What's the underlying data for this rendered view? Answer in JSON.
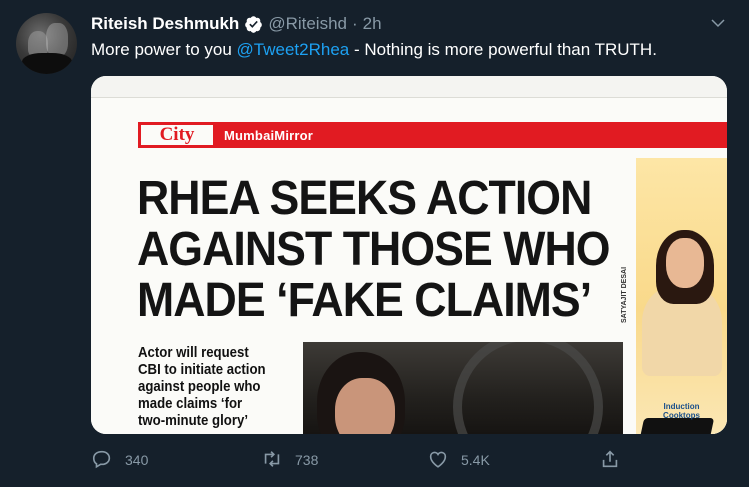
{
  "tweet": {
    "author": {
      "name": "Riteish Deshmukh",
      "handle": "@Riteishd",
      "separator": "·",
      "time": "2h",
      "verified": true
    },
    "text": {
      "before": "More power to you ",
      "mention": "@Tweet2Rhea",
      "after": " - Nothing is more powerful than TRUTH."
    },
    "media": {
      "section": "City",
      "masthead": "MumbaiMirror",
      "headline": [
        "RHEA SEEKS ACTION",
        "AGAINST THOSE WHO",
        "MADE ‘FAKE CLAIMS’"
      ],
      "subhead": [
        "Actor will request",
        "CBI to initiate action",
        "against people who",
        "made claims ‘for",
        "two-minute glory’"
      ],
      "photo_credit": "SATYAJIT DESAI",
      "ad_text": [
        "Induction",
        "Cooktops"
      ]
    },
    "actions": {
      "replies": "340",
      "retweets": "738",
      "likes": "5.4K"
    }
  },
  "colors": {
    "background": "#15202b",
    "secondary_text": "#8899a6",
    "link": "#1da1f2",
    "newspaper_red": "#e11b22"
  },
  "icons": [
    "verified-badge-icon",
    "chevron-down-icon",
    "reply-icon",
    "retweet-icon",
    "like-icon",
    "share-icon"
  ]
}
